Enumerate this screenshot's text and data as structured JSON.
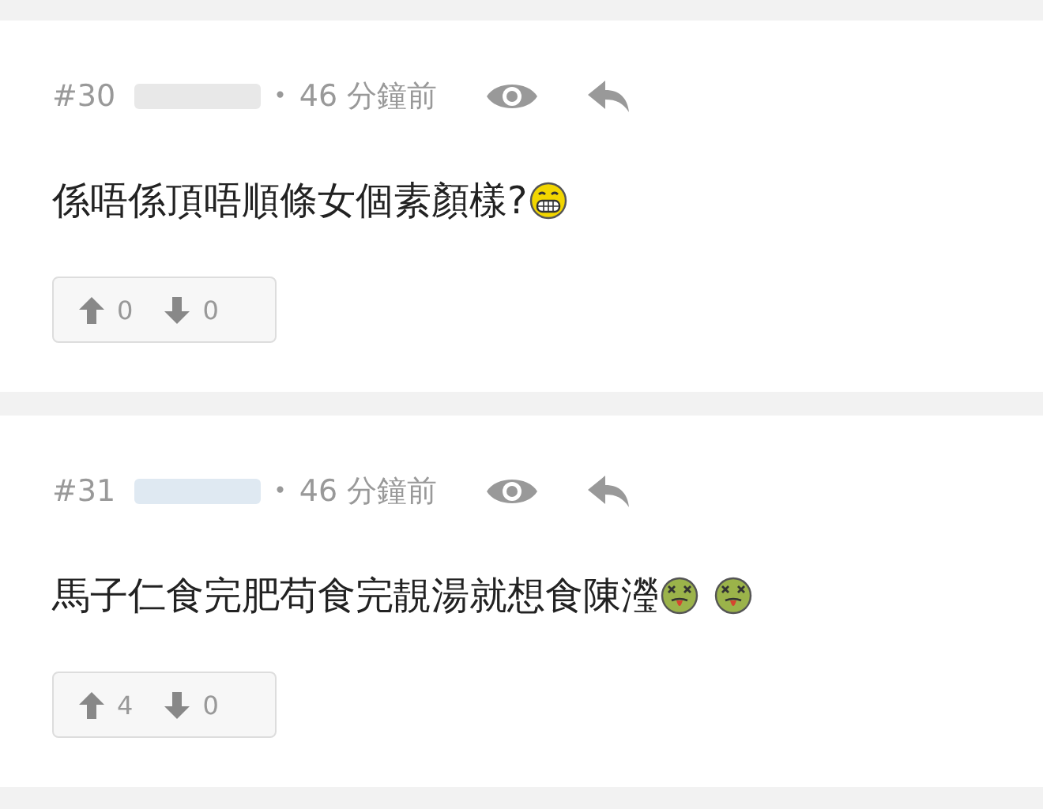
{
  "comments": [
    {
      "number": "#30",
      "separator": "•",
      "time": "46 分鐘前",
      "text": "係唔係頂唔順條女個素顏樣?",
      "emojis": [
        {
          "kind": "grin"
        }
      ],
      "upvotes": "0",
      "downvotes": "0"
    },
    {
      "number": "#31",
      "separator": "•",
      "time": "46 分鐘前",
      "text": "馬子仁食完肥苟食完靚湯就想食陳瀅",
      "emojis": [
        {
          "kind": "sick"
        },
        {
          "kind": "sick"
        }
      ],
      "upvotes": "4",
      "downvotes": "0"
    }
  ]
}
